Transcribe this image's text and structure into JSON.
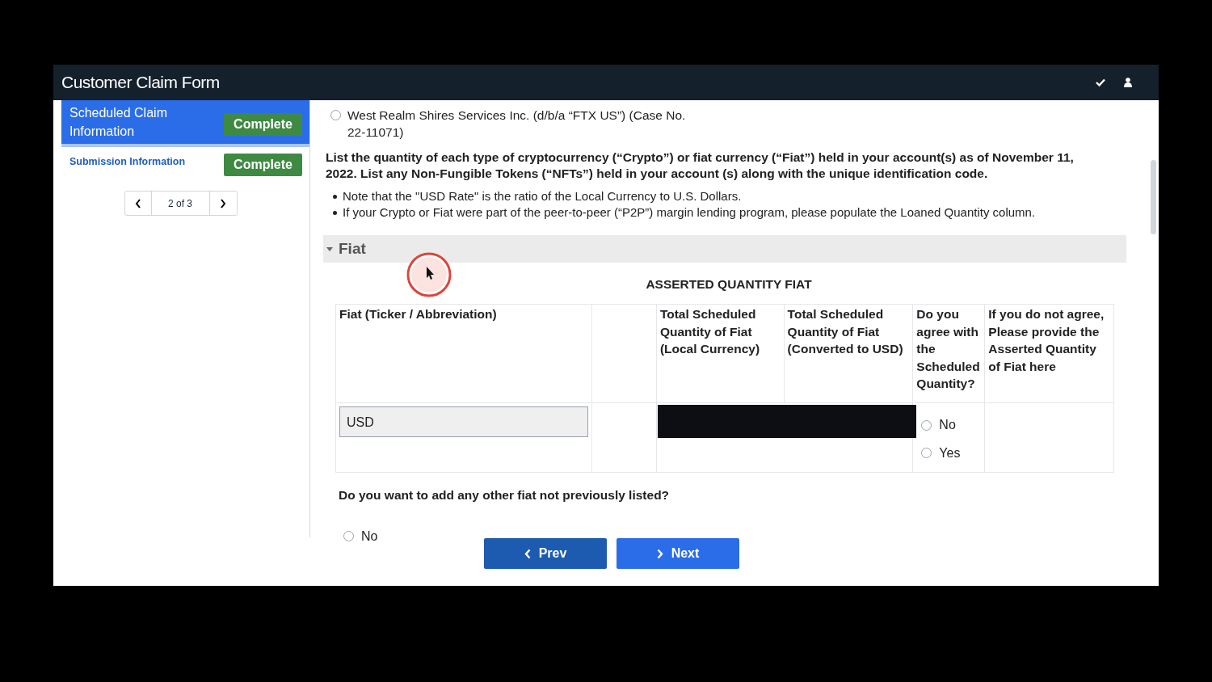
{
  "window": {
    "title": "Customer Claim Form"
  },
  "sidebar": {
    "items": [
      {
        "label": "Scheduled Claim Information",
        "status": "Complete",
        "selected": true
      },
      {
        "label": "Submission Information",
        "status": "Complete",
        "selected": false
      }
    ],
    "pager": {
      "text": "2 of 3"
    }
  },
  "content": {
    "radio_option": {
      "label": "West Realm Shires Services Inc. (d/b/a “FTX US”) (Case No. 22-11071)",
      "selected": false
    },
    "instructions": "List the quantity of each type of cryptocurrency (“Crypto”) or fiat currency (“Fiat”) held in your account(s) as of November 11, 2022. List any Non-Fungible Tokens (“NFTs”) held in your account (s) along with the unique identification code.",
    "notes": [
      "Note that the \"USD Rate\" is the ratio of the Local Currency to U.S. Dollars.",
      "If your Crypto or Fiat were part of the peer-to-peer (“P2P”) margin lending program, please populate the Loaned Quantity column."
    ],
    "section": {
      "title": "Fiat",
      "expanded": true
    },
    "table": {
      "caption": "ASSERTED QUANTITY FIAT",
      "columns": [
        "Fiat (Ticker / Abbreviation)",
        "",
        "Total Scheduled Quantity of Fiat (Local Currency)",
        "Total Scheduled Quantity of Fiat (Converted to USD)",
        "Do you agree with the Scheduled Quantity?",
        "If you do not agree, Please provide the Asserted Quantity of Fiat here"
      ],
      "rows": [
        {
          "fiat": "USD",
          "redacted": true,
          "agree_options": [
            {
              "label": "No",
              "selected": false
            },
            {
              "label": "Yes",
              "selected": false
            }
          ]
        }
      ]
    },
    "question": {
      "text": "Do you want to add any other fiat not previously listed?",
      "options": [
        {
          "label": "No",
          "selected": false
        }
      ]
    }
  },
  "buttons": [
    {
      "label": "Prev",
      "kind": "prev"
    },
    {
      "label": "Next",
      "kind": "next"
    }
  ]
}
